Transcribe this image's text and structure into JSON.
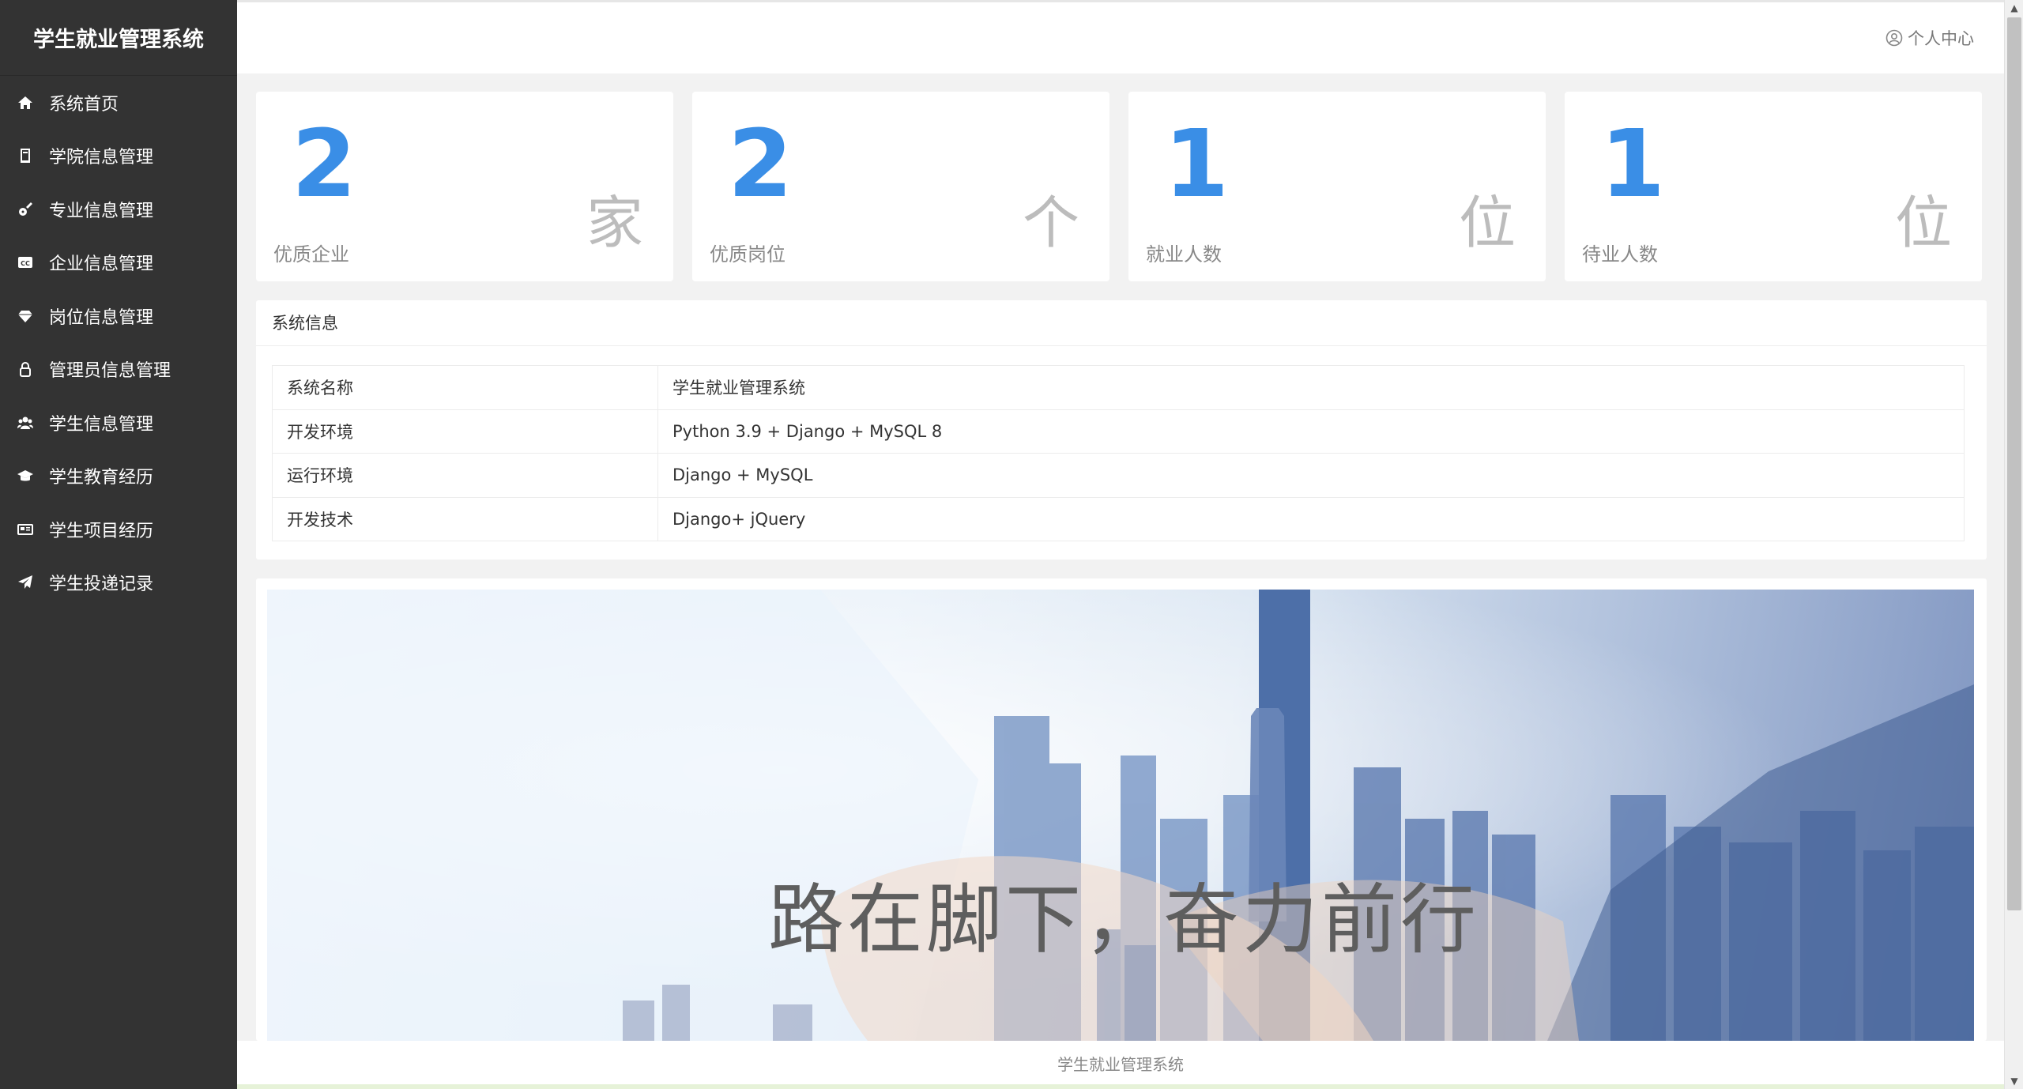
{
  "app": {
    "title": "学生就业管理系统"
  },
  "sidebar": {
    "items": [
      {
        "label": "系统首页",
        "icon": "home-icon"
      },
      {
        "label": "学院信息管理",
        "icon": "book-icon"
      },
      {
        "label": "专业信息管理",
        "icon": "guitar-icon"
      },
      {
        "label": "企业信息管理",
        "icon": "cc-icon"
      },
      {
        "label": "岗位信息管理",
        "icon": "diamond-icon"
      },
      {
        "label": "管理员信息管理",
        "icon": "lock-icon"
      },
      {
        "label": "学生信息管理",
        "icon": "users-icon"
      },
      {
        "label": "学生教育经历",
        "icon": "graduation-cap-icon"
      },
      {
        "label": "学生项目经历",
        "icon": "newspaper-icon"
      },
      {
        "label": "学生投递记录",
        "icon": "paper-plane-icon"
      }
    ]
  },
  "header": {
    "user_center": "个人中心"
  },
  "stats": [
    {
      "value": "2",
      "caption": "优质企业",
      "unit": "家"
    },
    {
      "value": "2",
      "caption": "优质岗位",
      "unit": "个"
    },
    {
      "value": "1",
      "caption": "就业人数",
      "unit": "位"
    },
    {
      "value": "1",
      "caption": "待业人数",
      "unit": "位"
    }
  ],
  "system_info": {
    "title": "系统信息",
    "rows": [
      {
        "key": "系统名称",
        "value": "学生就业管理系统"
      },
      {
        "key": "开发环境",
        "value": "Python 3.9 + Django + MySQL 8"
      },
      {
        "key": "运行环境",
        "value": "Django + MySQL"
      },
      {
        "key": "开发技术",
        "value": "Django+ jQuery"
      }
    ]
  },
  "banner": {
    "slogan": "路在脚下，奋力前行"
  },
  "footer": {
    "text": "学生就业管理系统"
  },
  "colors": {
    "sidebar_bg": "#333333",
    "accent_number": "#3a8ee6",
    "page_bg": "#f2f2f2"
  }
}
